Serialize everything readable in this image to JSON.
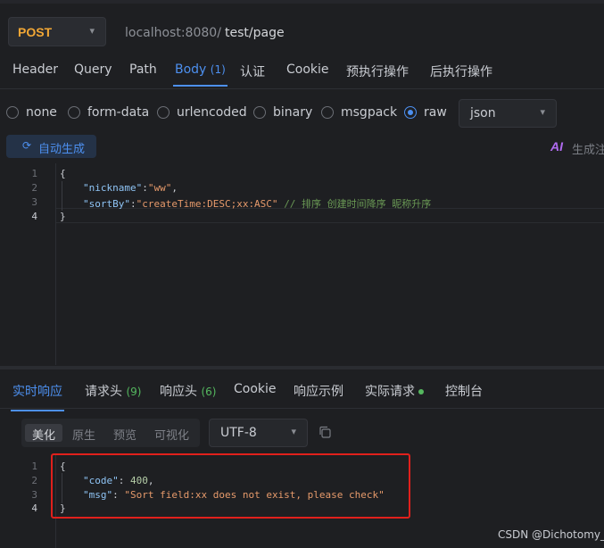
{
  "request": {
    "method": "POST",
    "host": "localhost:8080/",
    "path": "test/page"
  },
  "request_tabs": [
    {
      "label": "Header"
    },
    {
      "label": "Query"
    },
    {
      "label": "Path"
    },
    {
      "label": "Body",
      "count": "(1)"
    },
    {
      "label": "认证"
    },
    {
      "label": "Cookie"
    },
    {
      "label": "预执行操作"
    },
    {
      "label": "后执行操作"
    }
  ],
  "body_types": [
    "none",
    "form-data",
    "urlencoded",
    "binary",
    "msgpack",
    "raw"
  ],
  "body_type_selected": "raw",
  "raw_format": "json",
  "auto_generate_label": "自动生成",
  "ai_label": "AI",
  "ai_generate_text": "生成注",
  "request_code": {
    "line_numbers": [
      "1",
      "2",
      "3",
      "4"
    ],
    "open_brace": "{",
    "nickname_key": "\"nickname\"",
    "colon": ":",
    "nickname_value": "\"ww\"",
    "comma": ",",
    "sortby_key": "\"sortBy\"",
    "sortby_value": "\"createTime:DESC;xx:ASC\"",
    "comment": "// 排序 创建时间降序 昵称升序",
    "close_brace": "}"
  },
  "response_tabs": [
    {
      "label": "实时响应"
    },
    {
      "label": "请求头",
      "count": "(9)"
    },
    {
      "label": "响应头",
      "count": "(6)"
    },
    {
      "label": "Cookie"
    },
    {
      "label": "响应示例"
    },
    {
      "label": "实际请求"
    },
    {
      "label": "控制台"
    }
  ],
  "view_modes": [
    "美化",
    "原生",
    "预览",
    "可视化"
  ],
  "encoding": "UTF-8",
  "response_code": {
    "line_numbers": [
      "1",
      "2",
      "3",
      "4"
    ],
    "open_brace": "{",
    "code_key": "\"code\"",
    "code_value": "400",
    "msg_key": "\"msg\"",
    "msg_value": "\"Sort field:xx does not exist, please check\"",
    "close_brace": "}",
    "colon_space": ": ",
    "comma": ","
  },
  "watermark": "CSDN @Dichotomy_",
  "colors": {
    "accent": "#4d90f0",
    "method": "#f2a735",
    "highlight_box": "#e0201c"
  }
}
